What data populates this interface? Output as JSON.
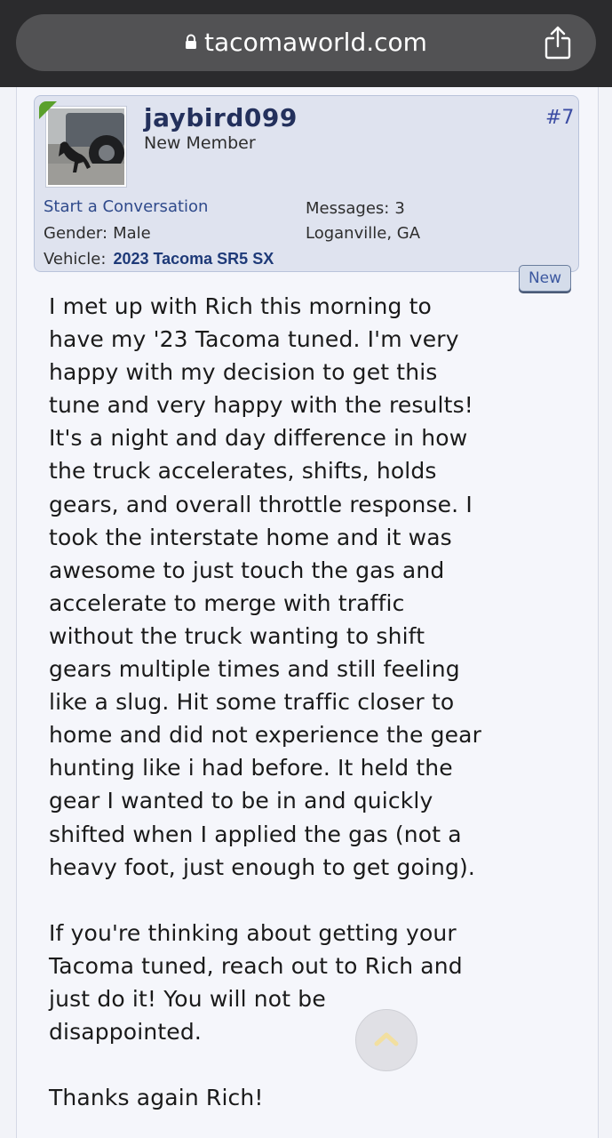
{
  "browser": {
    "url": "tacomaworld.com",
    "lock_icon": "lock-icon",
    "share_icon": "share-icon"
  },
  "user": {
    "name": "jaybird099",
    "title": "New Member",
    "post_number": "#7",
    "online": true,
    "start_conversation": "Start a Conversation",
    "gender_label": "Gender:",
    "gender_value": "Male",
    "vehicle_label": "Vehicle:",
    "vehicle_value": "2023 Tacoma SR5 SX",
    "messages_label": "Messages:",
    "messages_value": "3",
    "location": "Loganville, GA"
  },
  "new_badge": "New",
  "post": {
    "paragraph1": "I met up with Rich this morning to\nhave my '23 Tacoma tuned. I'm very\nhappy with my decision to get this\ntune and very happy with the results!\nIt's a night and day difference in how\nthe truck accelerates, shifts, holds\ngears, and overall throttle response. I\ntook the interstate home and it was\nawesome to just touch the gas and\naccelerate to merge with traffic\nwithout the truck wanting to shift\ngears multiple times and still feeling\nlike a slug. Hit some traffic closer to\nhome and did not experience the gear\nhunting like i had before. It held the\ngear I wanted to be in and quickly\nshifted when I applied the gas (not a\nheavy foot, just enough to get going).",
    "paragraph2": "If you're thinking about getting your\nTacoma tuned, reach out to Rich and\njust do it! You will not be\ndisappointed.",
    "paragraph3": "Thanks again Rich!"
  },
  "scroll_top_icon": "chevron-up-icon",
  "colors": {
    "chrome": "#2b2b2d",
    "urlbar": "#525254",
    "userbox": "#dfe3ef",
    "username": "#23305c",
    "link": "#2f4a8b",
    "online": "#5aa02c"
  }
}
